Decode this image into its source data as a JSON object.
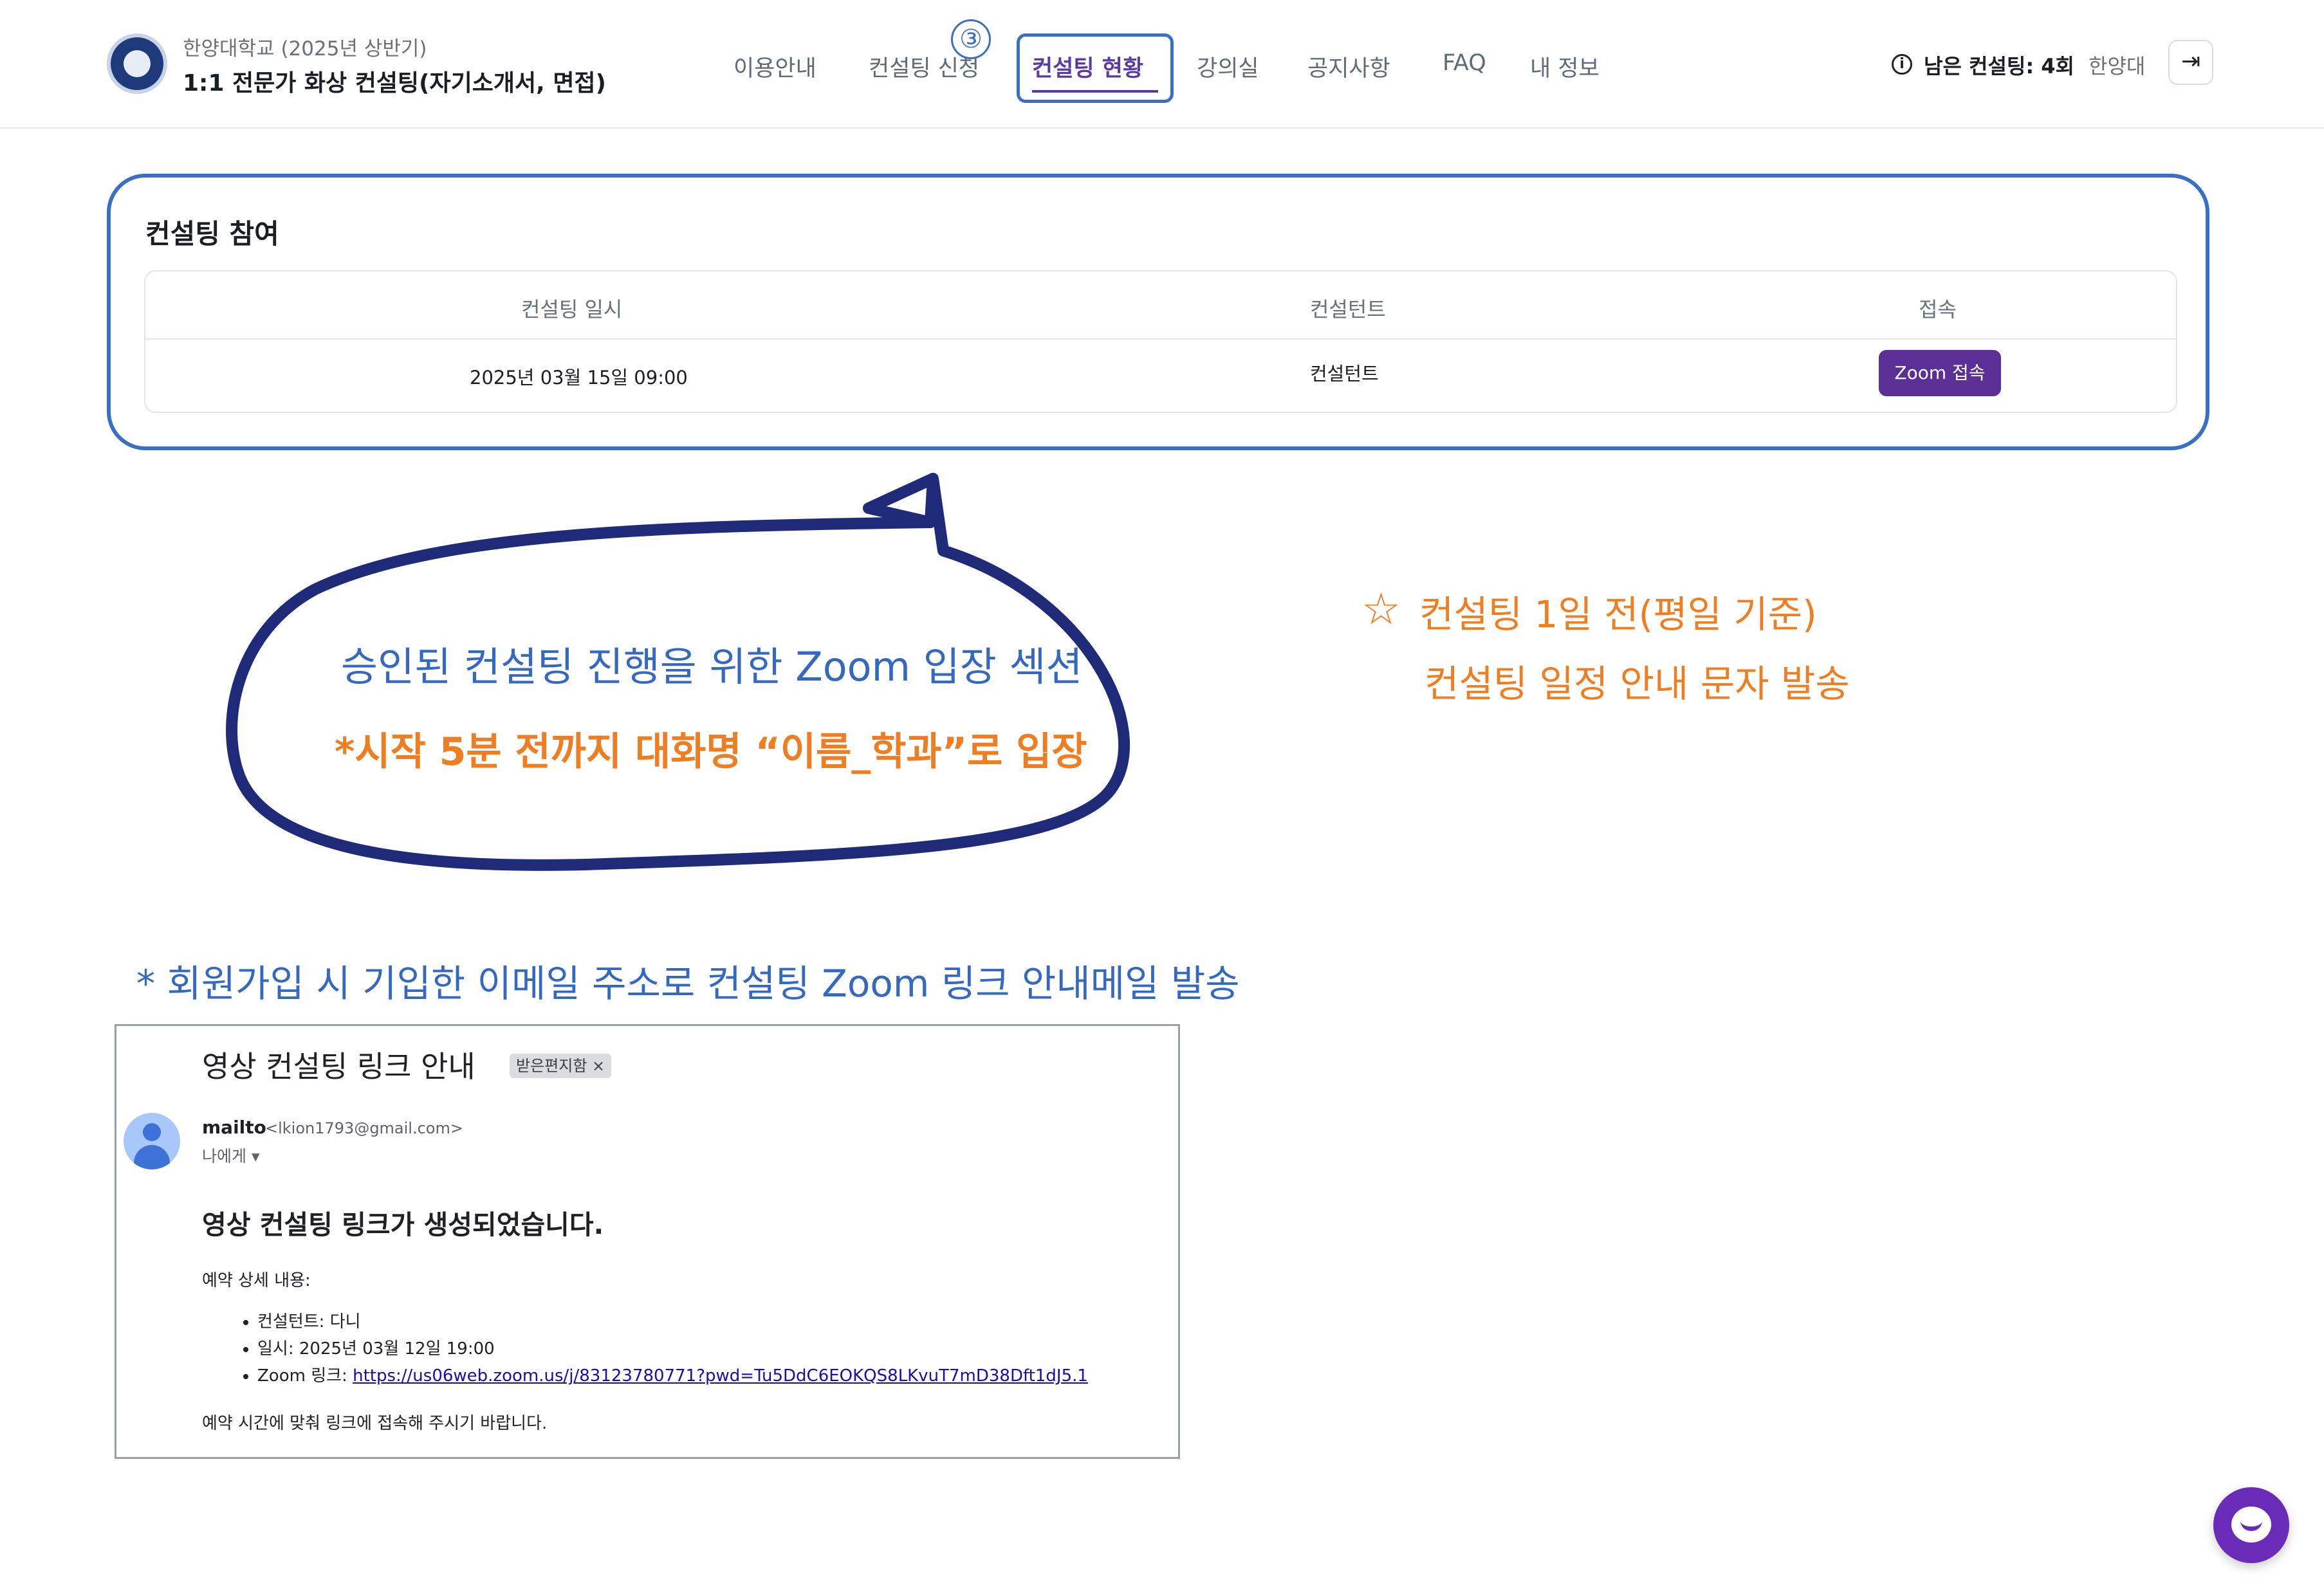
{
  "header": {
    "org": "한양대학교 (2025년 상반기)",
    "program_title": "1:1 전문가 화상 컨설팅(자기소개서, 면접)",
    "nav": [
      {
        "label": "이용안내"
      },
      {
        "label": "컨설팅 신청"
      },
      {
        "label": "컨설팅 현황"
      },
      {
        "label": "강의실"
      },
      {
        "label": "공지사항"
      },
      {
        "label": "FAQ"
      },
      {
        "label": "내 정보"
      }
    ],
    "active_tab": "컨설팅 현황",
    "step_marker": "③",
    "remaining": "남은 컨설팅: 4회",
    "user": "한양대",
    "logout_icon": "logout-icon",
    "info_icon": "info-icon"
  },
  "participation": {
    "title": "컨설팅 참여",
    "columns": [
      "컨설팅 일시",
      "컨설턴트",
      "접속"
    ],
    "rows": [
      {
        "datetime": "2025년 03월 15일 09:00",
        "consultant": "컨설턴트",
        "action": "Zoom 접속"
      }
    ]
  },
  "annotations": {
    "bubble_line1": "승인된 컨설팅 진행을 위한 Zoom 입장 섹션",
    "bubble_line2": "*시작 5분 전까지 대화명 “이름_학과”로 입장",
    "star": "☆",
    "note_line1": "컨설팅 1일 전(평일 기준)",
    "note_line2": "컨설팅 일정 안내 문자 발송",
    "email_note": "* 회원가입 시 기입한 이메일 주소로 컨설팅 Zoom 링크 안내메일 발송"
  },
  "email": {
    "subject": "영상 컨설팅 링크 안내",
    "label_chip": "받은편지함 ×",
    "sender_name": "mailto",
    "sender_email": "<lkion1793@gmail.com>",
    "to": "나에게 ▾",
    "heading": "영상 컨설팅 링크가 생성되었습니다.",
    "intro": "예약 상세 내용:",
    "items": [
      {
        "label": "컨설턴트: 다니"
      },
      {
        "label": "일시: 2025년 03월 12일 19:00"
      }
    ],
    "zoom_prefix": "Zoom 링크: ",
    "zoom_link": "https://us06web.zoom.us/j/83123780771?pwd=Tu5DdC6EOKQS8LKvuT7mD38Dft1dJ5.1",
    "closing": "예약 시간에 맞춰 링크에 접속해 주시기 바랍니다."
  },
  "colors": {
    "accent_purple": "#5b3096",
    "annotation_blue": "#3568c0",
    "annotation_orange": "#ef7d22",
    "bubble_stroke": "#1f2a78",
    "highlight_box": "#3b6fc4"
  }
}
